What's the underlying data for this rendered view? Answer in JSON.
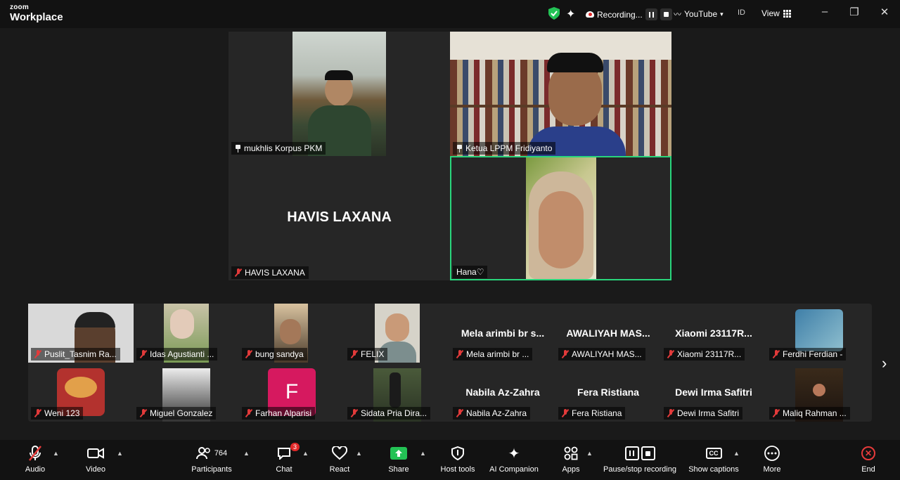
{
  "app": {
    "brand_top": "zoom",
    "brand_bottom": "Workplace"
  },
  "titlebar": {
    "recording_label": "Recording...",
    "youtube_label": "YouTube",
    "lang_label": "ID",
    "view_label": "View"
  },
  "gallery": {
    "tiles": [
      {
        "name": "mukhlis Korpus PKM"
      },
      {
        "name": "Ketua LPPM Fridiyanto"
      },
      {
        "name": "HAVIS LAXANA",
        "big_name": "HAVIS LAXANA"
      },
      {
        "name": "Hana♡"
      }
    ]
  },
  "strip": {
    "row1": [
      {
        "name": "Puslit_Tasnim Ra...",
        "title": ""
      },
      {
        "name": "Idas Agustianti ...",
        "title": ""
      },
      {
        "name": "bung sandya",
        "title": ""
      },
      {
        "name": "FELIX",
        "title": ""
      },
      {
        "name": "Mela arimbi br ...",
        "title": "Mela arimbi br s..."
      },
      {
        "name": "AWALIYAH MAS...",
        "title": "AWALIYAH MAS..."
      },
      {
        "name": "Xiaomi 23117R...",
        "title": "Xiaomi 23117R..."
      },
      {
        "name": "Ferdhi Ferdian -",
        "title": ""
      }
    ],
    "row2": [
      {
        "name": "Weni 123",
        "title": ""
      },
      {
        "name": "Miguel Gonzalez",
        "title": ""
      },
      {
        "name": "Farhan Alparisi",
        "title": "",
        "avatar_letter": "F"
      },
      {
        "name": "Sidata Pria Dira...",
        "title": ""
      },
      {
        "name": "Nabila Az-Zahra",
        "title": "Nabila Az-Zahra"
      },
      {
        "name": "Fera Ristiana",
        "title": "Fera Ristiana"
      },
      {
        "name": "Dewi Irma Safitri",
        "title": "Dewi Irma Safitri"
      },
      {
        "name": "Maliq Rahman ...",
        "title": ""
      }
    ]
  },
  "toolbar": {
    "audio": "Audio",
    "video": "Video",
    "participants": "Participants",
    "participants_count": "764",
    "chat": "Chat",
    "chat_badge": "3",
    "react": "React",
    "share": "Share",
    "host_tools": "Host tools",
    "ai_companion": "AI Companion",
    "apps": "Apps",
    "pause_stop": "Pause/stop recording",
    "captions": "Show captions",
    "more": "More",
    "end": "End"
  },
  "colors": {
    "active_speaker": "#29d67c",
    "share": "#23c255",
    "end": "#e83b3b",
    "muted": "#e23a3a",
    "avatar_f": "#d6195f"
  }
}
